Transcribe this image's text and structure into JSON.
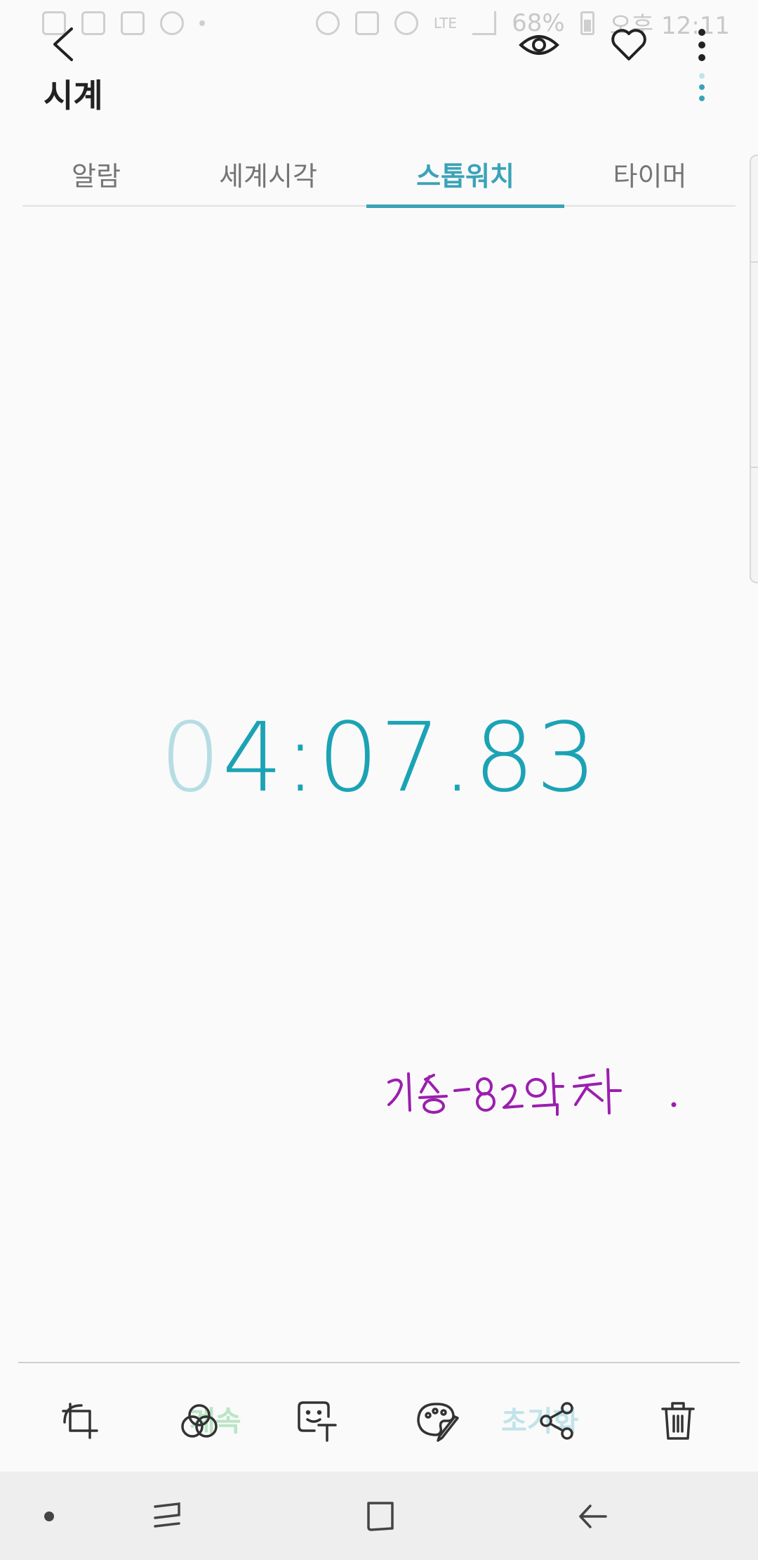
{
  "status_bar": {
    "battery": "68%",
    "time": "오후 12:11",
    "network": "LTE"
  },
  "app": {
    "title": "시계"
  },
  "tabs": [
    {
      "label": "알람"
    },
    {
      "label": "세계시각"
    },
    {
      "label": "스톱워치",
      "selected": true
    },
    {
      "label": "타이머"
    }
  ],
  "stopwatch": {
    "lead_digit": "0",
    "rest": "4:07.83"
  },
  "annotation": {
    "text": "리뷰 - 82일차"
  },
  "buttons": {
    "continue": "계속",
    "reset": "초기화"
  },
  "colors": {
    "accent": "#3aa3b8",
    "digits": "#1ba3b5",
    "annotation_ink": "#9b1fae"
  },
  "icons": {
    "toolbar": [
      "crop-rotate-icon",
      "filter-icon",
      "sticker-text-icon",
      "palette-icon",
      "share-icon",
      "trash-icon"
    ],
    "top": [
      "back-icon",
      "eye-icon",
      "heart-icon",
      "more-icon"
    ]
  }
}
